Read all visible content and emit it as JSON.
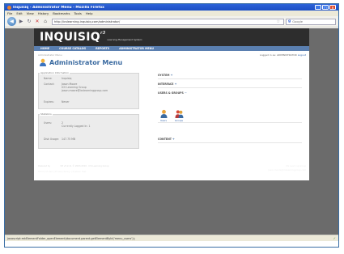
{
  "window": {
    "title": "Inquisiq - Administrator Menu - Mozilla Firefox",
    "minimize": "_",
    "maximize": "□",
    "close": "×"
  },
  "menubar": [
    "File",
    "Edit",
    "View",
    "History",
    "Bookmarks",
    "Tools",
    "Help"
  ],
  "navbar": {
    "back": "◀",
    "forward": "▶",
    "reload": "↻",
    "stop": "✕",
    "home": "⌂",
    "url": "http://icslearning.inquisiq.com/administrator/",
    "star": "☆",
    "search_engine": "g",
    "search_placeholder": "Google"
  },
  "header": {
    "logo": "INQUISIQ",
    "logo_sup": "r3",
    "tagline": "Learning Management System"
  },
  "nav": [
    "HOME",
    "COURSE CATALOG",
    "REPORTS",
    "ADMINISTRATOR MENU"
  ],
  "main": {
    "breadcrumb": "Administrator Menu",
    "logged_in_prefix": "Logged in as: ADMINISTRATOR",
    "logout": "Logout",
    "title": "Administrator Menu",
    "app_info": {
      "title": "Application Information",
      "name_label": "Name:",
      "name_value": "Inquisiq",
      "contact_label": "Contact:",
      "contact_line1": "Jason Moore",
      "contact_line2": "ICS Learning Group",
      "contact_line3": "jason.moore@icslearninggroup.com",
      "expires_label": "Expires:",
      "expires_value": "Never"
    },
    "statistics": {
      "title": "Statistics",
      "users_label": "Users:",
      "users_value": "2",
      "users_sub": "Currently Logged In: 1",
      "disk_label": "Disk Usage:",
      "disk_value": "147.75 MB"
    },
    "sections": {
      "system": "SYSTEM",
      "interface": "INTERFACE",
      "users_groups": "USERS & GROUPS",
      "content": "CONTENT",
      "toggle_plus": "+",
      "toggle_minus": "−",
      "users_link": "Users",
      "groups_link": "Groups"
    }
  },
  "footer": {
    "powered_prefix": "Powered by",
    "powered_product": "Inquisiq",
    "powered_rest": "R3 v3.2.11 © 2003-2010 · ICS Learning Group",
    "links": "Terms of Use | Privacy Policy | System Test",
    "company": "ICS Learning Group",
    "email": "jason.moore@icslearninggroup.com"
  },
  "statusbar": {
    "text": "javascript:mkElementFolder_openElement(document.parent.getElementById('menu_users'));",
    "icon": "✓"
  },
  "colors": {
    "title_bar": "#1c4fc4",
    "header_bg": "#2d2d2d",
    "nav_bg": "#5a7fb0",
    "accent": "#3a6aa0",
    "link": "#2b5ea8"
  }
}
